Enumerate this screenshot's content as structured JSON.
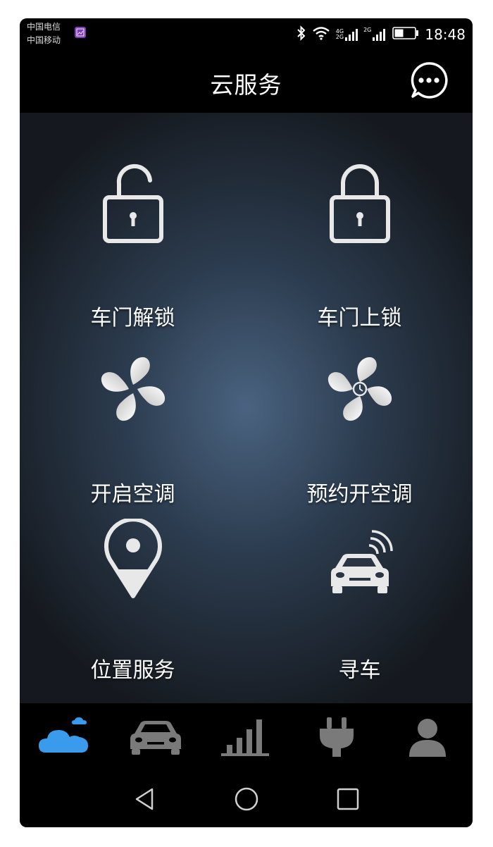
{
  "status_bar": {
    "carrier_1": "中国电信",
    "carrier_2": "中国移动",
    "network_1": "4G",
    "network_2": "2G",
    "network_3": "2G",
    "time": "18:48"
  },
  "header": {
    "title": "云服务"
  },
  "services": [
    {
      "label": "车门解锁",
      "icon": "unlock-icon"
    },
    {
      "label": "车门上锁",
      "icon": "lock-icon"
    },
    {
      "label": "开启空调",
      "icon": "fan-icon"
    },
    {
      "label": "预约开空调",
      "icon": "fan-timer-icon"
    },
    {
      "label": "位置服务",
      "icon": "location-pin-icon"
    },
    {
      "label": "寻车",
      "icon": "car-signal-icon"
    }
  ],
  "tabs": [
    {
      "icon": "cloud-icon",
      "active": true
    },
    {
      "icon": "car-icon",
      "active": false
    },
    {
      "icon": "bar-chart-icon",
      "active": false
    },
    {
      "icon": "plug-icon",
      "active": false
    },
    {
      "icon": "person-icon",
      "active": false
    }
  ],
  "colors": {
    "active_tab": "#3a9bec",
    "inactive_tab": "#7a7a7a",
    "background": "#000000"
  }
}
